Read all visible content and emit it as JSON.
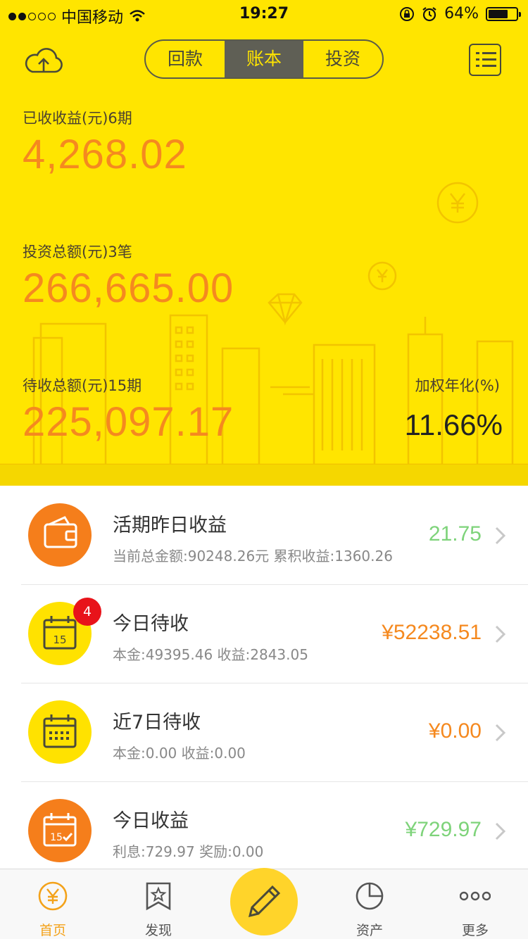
{
  "status_bar": {
    "carrier": "中国移动",
    "time": "19:27",
    "battery": "64%"
  },
  "header": {
    "tabs": [
      {
        "label": "回款",
        "active": false
      },
      {
        "label": "账本",
        "active": true
      },
      {
        "label": "投资",
        "active": false
      }
    ],
    "earned_label": "已收收益(元)6期",
    "earned_value": "4,268.02",
    "invest_label": "投资总额(元)3笔",
    "invest_value": "266,665.00",
    "pending_label": "待收总额(元)15期",
    "pending_value": "225,097.17",
    "rate_label": "加权年化(%)",
    "rate_value": "11.66%",
    "colors": {
      "background": "#ffe500",
      "amount": "#f5891f"
    }
  },
  "list": [
    {
      "title": "活期昨日收益",
      "sub": "当前总金额:90248.26元  累积收益:1360.26",
      "amount": "21.75",
      "amount_color": "#7ed37a",
      "icon": "wallet-icon",
      "icon_color": "#f57e1b"
    },
    {
      "title": "今日待收",
      "sub": "本金:49395.46  收益:2843.05",
      "amount": "¥52238.51",
      "amount_color": "#f5891f",
      "icon": "calendar-15-icon",
      "icon_color": "#ffe200",
      "badge": "4"
    },
    {
      "title": "近7日待收",
      "sub": "本金:0.00  收益:0.00",
      "amount": "¥0.00",
      "amount_color": "#f5891f",
      "icon": "calendar-week-icon",
      "icon_color": "#ffe200"
    },
    {
      "title": "今日收益",
      "sub": "利息:729.97  奖励:0.00",
      "amount": "¥729.97",
      "amount_color": "#7ed37a",
      "icon": "calendar-check-icon",
      "icon_color": "#f57e1b"
    }
  ],
  "tabbar": {
    "items": [
      {
        "label": "首页",
        "icon": "yuan-coin-icon",
        "active": true
      },
      {
        "label": "发现",
        "icon": "bookmark-star-icon",
        "active": false
      },
      {
        "label": "",
        "icon": "pencil-icon",
        "active": false
      },
      {
        "label": "资产",
        "icon": "pie-chart-icon",
        "active": false
      },
      {
        "label": "更多",
        "icon": "more-dots-icon",
        "active": false
      }
    ],
    "active_color": "#f3a21a"
  }
}
